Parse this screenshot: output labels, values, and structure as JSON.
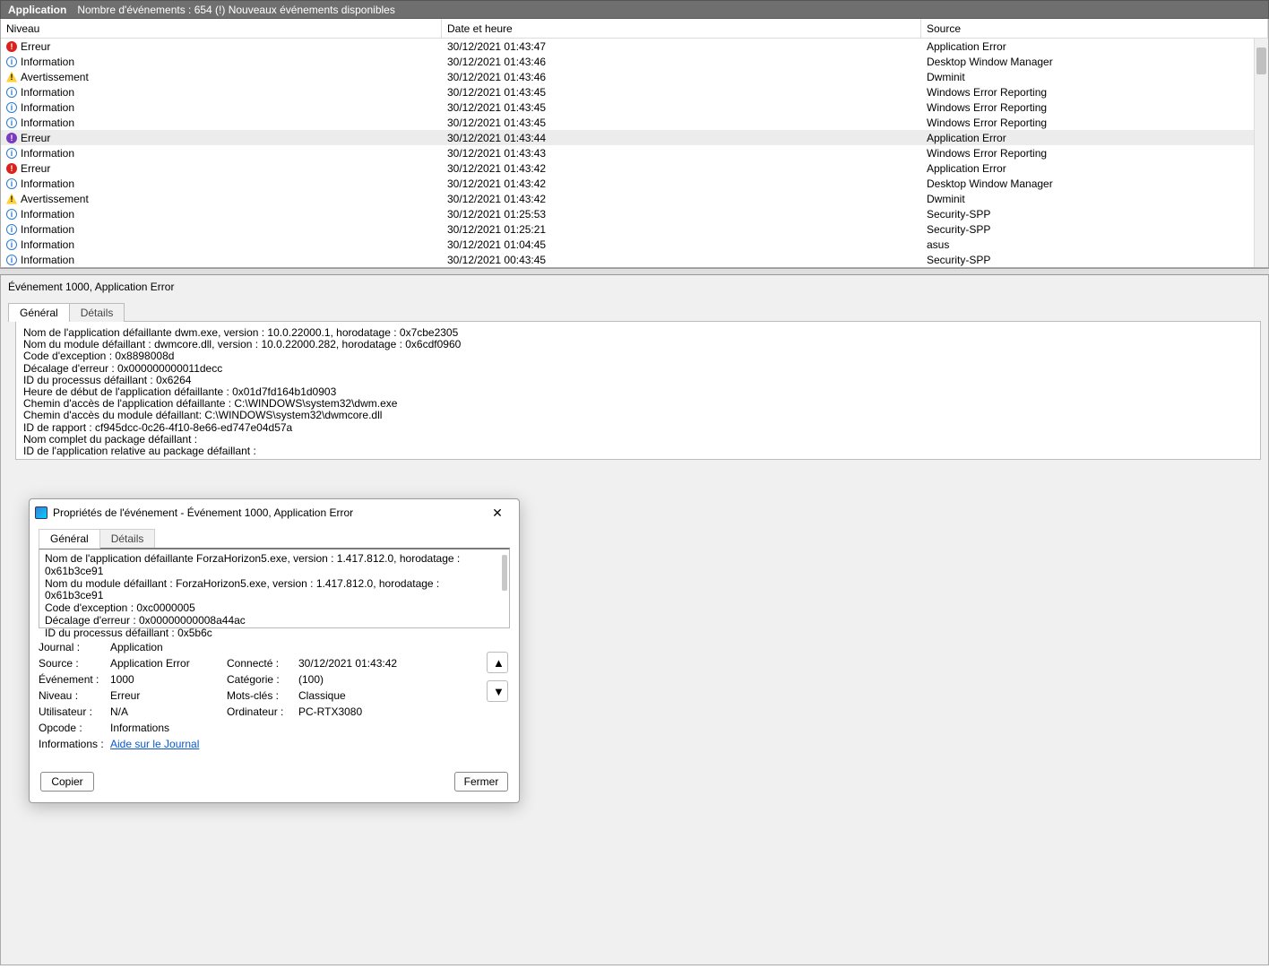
{
  "appbar": {
    "title": "Application",
    "subtitle": "Nombre d'événements : 654 (!) Nouveaux événements disponibles"
  },
  "columns": {
    "level": "Niveau",
    "date": "Date et heure",
    "source": "Source"
  },
  "rows": [
    {
      "icon": "error",
      "level": "Erreur",
      "date": "30/12/2021 01:43:47",
      "source": "Application Error"
    },
    {
      "icon": "info",
      "level": "Information",
      "date": "30/12/2021 01:43:46",
      "source": "Desktop Window Manager"
    },
    {
      "icon": "warn",
      "level": "Avertissement",
      "date": "30/12/2021 01:43:46",
      "source": "Dwminit"
    },
    {
      "icon": "info",
      "level": "Information",
      "date": "30/12/2021 01:43:45",
      "source": "Windows Error Reporting"
    },
    {
      "icon": "info",
      "level": "Information",
      "date": "30/12/2021 01:43:45",
      "source": "Windows Error Reporting"
    },
    {
      "icon": "info",
      "level": "Information",
      "date": "30/12/2021 01:43:45",
      "source": "Windows Error Reporting"
    },
    {
      "icon": "error",
      "alt": true,
      "level": "Erreur",
      "date": "30/12/2021 01:43:44",
      "source": "Application Error",
      "selected": true
    },
    {
      "icon": "info",
      "level": "Information",
      "date": "30/12/2021 01:43:43",
      "source": "Windows Error Reporting"
    },
    {
      "icon": "error",
      "level": "Erreur",
      "date": "30/12/2021 01:43:42",
      "source": "Application Error"
    },
    {
      "icon": "info",
      "level": "Information",
      "date": "30/12/2021 01:43:42",
      "source": "Desktop Window Manager"
    },
    {
      "icon": "warn",
      "level": "Avertissement",
      "date": "30/12/2021 01:43:42",
      "source": "Dwminit"
    },
    {
      "icon": "info",
      "level": "Information",
      "date": "30/12/2021 01:25:53",
      "source": "Security-SPP"
    },
    {
      "icon": "info",
      "level": "Information",
      "date": "30/12/2021 01:25:21",
      "source": "Security-SPP"
    },
    {
      "icon": "info",
      "level": "Information",
      "date": "30/12/2021 01:04:45",
      "source": "asus"
    },
    {
      "icon": "info",
      "level": "Information",
      "date": "30/12/2021 00:43:45",
      "source": "Security-SPP"
    }
  ],
  "detail": {
    "heading": "Événement 1000, Application Error",
    "tabs": {
      "general": "Général",
      "details": "Détails"
    },
    "text": "Nom de l'application défaillante dwm.exe, version : 10.0.22000.1, horodatage : 0x7cbe2305\nNom du module défaillant : dwmcore.dll, version : 10.0.22000.282, horodatage : 0x6cdf0960\nCode d'exception : 0x8898008d\nDécalage d'erreur : 0x000000000011decc\nID du processus défaillant : 0x6264\nHeure de début de l'application défaillante : 0x01d7fd164b1d0903\nChemin d'accès de l'application défaillante : C:\\WINDOWS\\system32\\dwm.exe\nChemin d'accès du module défaillant: C:\\WINDOWS\\system32\\dwmcore.dll\nID de rapport : cf945dcc-0c26-4f10-8e66-ed747e04d57a\nNom complet du package défaillant :\nID de l'application relative au package défaillant :"
  },
  "dialog": {
    "title": "Propriétés de l'événement - Événement 1000, Application Error",
    "tabs": {
      "general": "Général",
      "details": "Détails"
    },
    "text": "Nom de l'application défaillante ForzaHorizon5.exe, version : 1.417.812.0, horodatage : 0x61b3ce91\nNom du module défaillant : ForzaHorizon5.exe, version : 1.417.812.0, horodatage : 0x61b3ce91\nCode d'exception : 0xc0000005\nDécalage d'erreur : 0x00000000008a44ac\nID du processus défaillant : 0x5b6c",
    "labels": {
      "journal": "Journal :",
      "journal_v": "Application",
      "source": "Source :",
      "source_v": "Application Error",
      "event": "Événement :",
      "event_v": "1000",
      "level": "Niveau :",
      "level_v": "Erreur",
      "user": "Utilisateur :",
      "user_v": "N/A",
      "opcode": "Opcode :",
      "opcode_v": "Informations",
      "info": "Informations :",
      "info_link": "Aide sur le Journal",
      "connected": "Connecté :",
      "connected_v": "30/12/2021 01:43:42",
      "category": "Catégorie :",
      "category_v": "(100)",
      "keywords": "Mots-clés :",
      "keywords_v": "Classique",
      "computer": "Ordinateur :",
      "computer_v": "PC-RTX3080"
    },
    "buttons": {
      "copy": "Copier",
      "close": "Fermer"
    }
  }
}
